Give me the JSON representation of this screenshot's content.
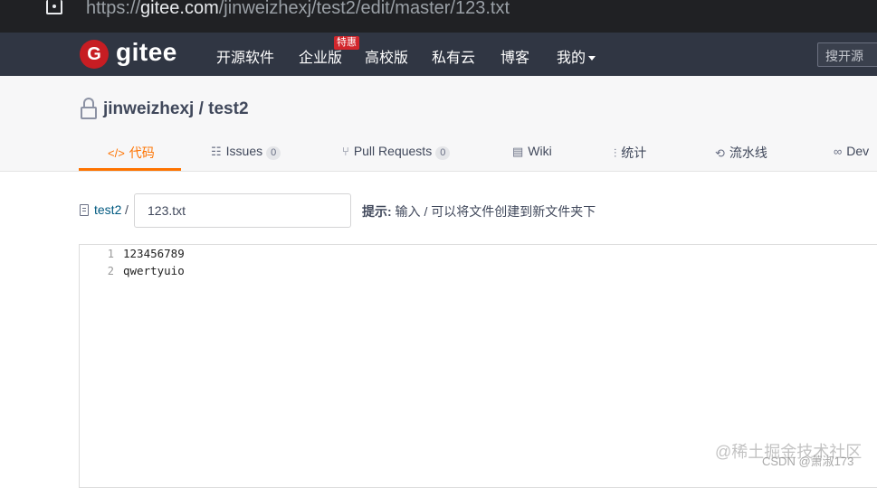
{
  "browser": {
    "url_prefix": "https://",
    "url_domain": "gitee.com",
    "url_path": "/jinweizhexj/test2/edit/master/123.txt"
  },
  "header": {
    "logo_text": "gitee",
    "logo_letter": "G",
    "nav": [
      {
        "label": "开源软件"
      },
      {
        "label": "企业版"
      },
      {
        "label": "高校版"
      },
      {
        "label": "私有云"
      },
      {
        "label": "博客"
      },
      {
        "label": "我的"
      }
    ],
    "hot_badge": "特惠",
    "search_placeholder": "搜开源"
  },
  "project": {
    "owner": "jinweizhexj",
    "separator": " / ",
    "name": "test2",
    "tabs": [
      {
        "icon": "</>",
        "label": "代码",
        "active": true
      },
      {
        "icon": "☷",
        "label": "Issues",
        "count": "0"
      },
      {
        "icon": "⑂",
        "label": "Pull Requests",
        "count": "0"
      },
      {
        "icon": "▤",
        "label": "Wiki"
      },
      {
        "icon": "⫶",
        "label": "统计"
      },
      {
        "icon": "⟲",
        "label": "流水线"
      },
      {
        "icon": "∞",
        "label": "Dev"
      }
    ]
  },
  "editor_path": {
    "repo_link": "test2",
    "separator": "/",
    "filename": "123.txt",
    "hint_label": "提示:",
    "hint_text": " 输入 / 可以将文件创建到新文件夹下"
  },
  "editor": {
    "lines": [
      {
        "no": "1",
        "text": "123456789"
      },
      {
        "no": "2",
        "text": "qwertyuio"
      }
    ]
  },
  "watermark": {
    "line1": "@稀土掘金技术社区",
    "line2": "CSDN @萧淑173"
  }
}
